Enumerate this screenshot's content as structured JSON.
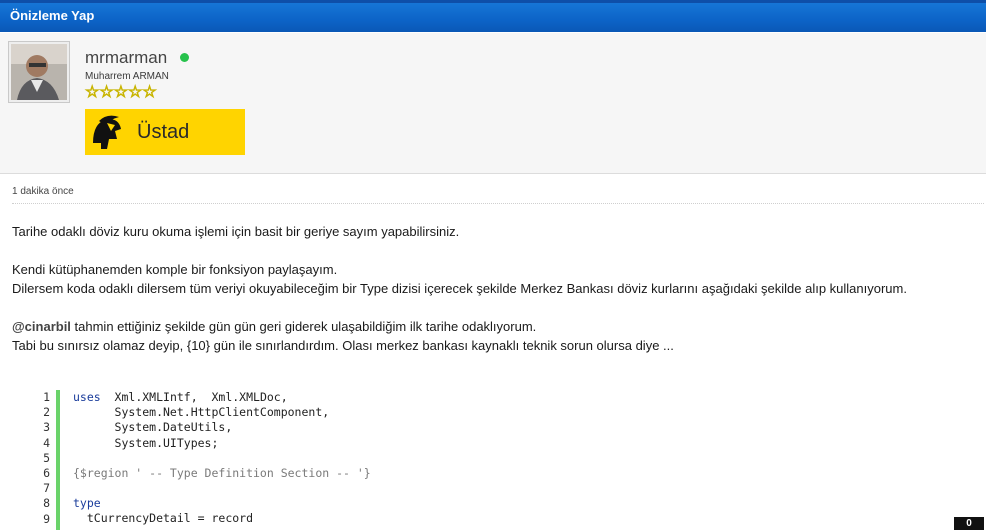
{
  "window": {
    "title": "Önizleme Yap"
  },
  "profile": {
    "username": "mrmarman",
    "full_name": "Muharrem ARMAN",
    "stars": "☆☆☆☆☆",
    "rank": "Üstad"
  },
  "post": {
    "time": "1 dakika önce",
    "lines": [
      "Tarihe odaklı döviz kuru okuma işlemi için basit bir geriye sayım yapabilirsiniz.",
      "Kendi kütüphanemden komple bir fonksiyon paylaşayım.",
      "Dilersem koda odaklı dilersem tüm veriyi okuyabileceğim bir Type dizisi içerecek şekilde Merkez Bankası döviz kurlarını aşağıdaki şekilde alıp kullanıyorum.",
      "@cinarbil",
      " tahmin ettiğiniz şekilde gün gün geri giderek ulaşabildiğim ilk tarihe odaklıyorum.",
      "Tabi bu sınırsız olamaz deyip, {10} gün ile sınırlandırdım. Olası merkez bankası kaynaklı teknik sorun olursa diye ..."
    ]
  },
  "code": {
    "line_numbers": [
      "1",
      "2",
      "3",
      "4",
      "5",
      "6",
      "7",
      "8",
      "9"
    ],
    "lines": [
      "uses",
      "  Xml.XMLIntf,  Xml.XMLDoc,",
      "      System.Net.HttpClientComponent,",
      "      System.DateUtils,",
      "      System.UITypes;",
      "",
      "{$region ' -- Type Definition Section -- '}",
      "",
      "type",
      "  tCurrencyDetail = record"
    ]
  },
  "counter": "0"
}
